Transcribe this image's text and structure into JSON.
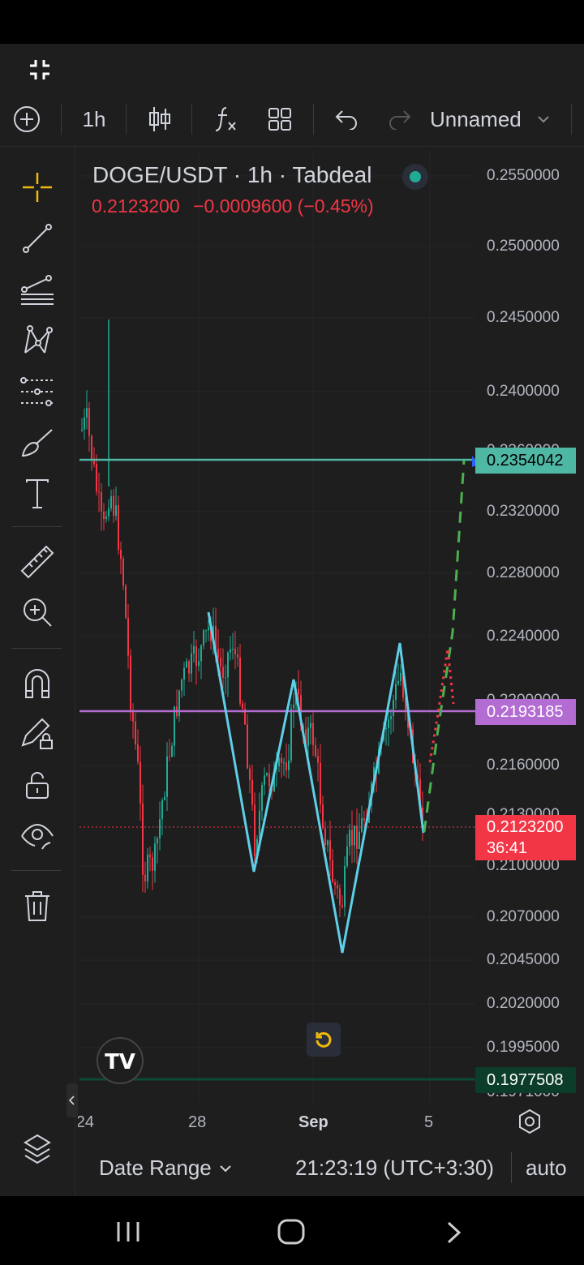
{
  "header": {
    "symbol": "DOGE/USDT · 1h · Tabdeal",
    "price": "0.2123200",
    "change": "−0.0009600 (−0.45%)"
  },
  "toolbar": {
    "interval": "1h",
    "layout_name": "Unnamed",
    "add_icon": "plus-circle-icon",
    "candles_icon": "candles-icon",
    "indicators_icon": "fx-icon",
    "templates_icon": "grid-icon",
    "undo_icon": "undo-icon",
    "redo_icon": "redo-icon"
  },
  "left_tools": [
    "crosshair-icon",
    "trend-line-icon",
    "fib-icon",
    "pattern-icon",
    "prediction-icon",
    "brush-icon",
    "text-icon",
    "ruler-icon",
    "zoom-in-icon",
    "magnet-icon",
    "lock-drawing-icon",
    "unlock-icon",
    "eye-icon",
    "trash-icon",
    "layers-icon"
  ],
  "price_axis": {
    "labels": [
      "0.2550000",
      "0.2500000",
      "0.2450000",
      "0.2400000",
      "0.2320000",
      "0.2280000",
      "0.2240000",
      "0.2160000",
      "0.2100000",
      "0.2070000",
      "0.2045000",
      "0.2020000",
      "0.1995000"
    ],
    "hidden_labels": [
      "0.2360000",
      "0.2200000",
      "0.2130000",
      "0.1971000"
    ]
  },
  "price_tags": {
    "green_line": "0.2354042",
    "purple_line": "0.2193185",
    "last_price": "0.2123200",
    "countdown": "36:41",
    "bottom_line": "0.1977508"
  },
  "time_axis": [
    "24",
    "28",
    "Sep",
    "5"
  ],
  "footer": {
    "date_range": "Date Range",
    "clock": "21:23:19 (UTC+3:30)",
    "scale_mode": "auto"
  },
  "colors": {
    "up": "#22ab94",
    "down": "#f23645",
    "pattern_line": "#5ecfe8",
    "level_green": "#4fb8a4",
    "level_purple": "#b36cd1"
  }
}
